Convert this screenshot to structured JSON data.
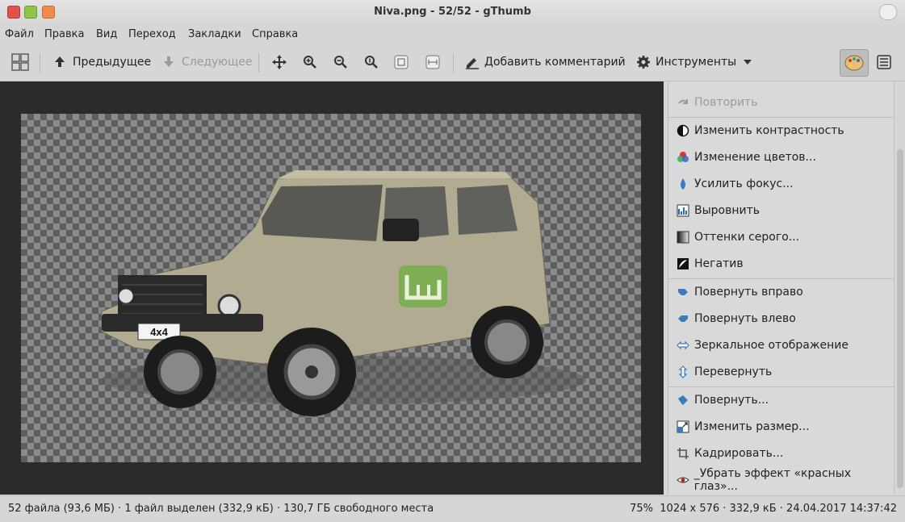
{
  "window": {
    "title": "Niva.png - 52/52 - gThumb"
  },
  "menu": [
    "Файл",
    "Правка",
    "Вид",
    "Переход",
    "Закладки",
    "Справка"
  ],
  "toolbar": {
    "prev_label": "Предыдущее",
    "next_label": "Следующее",
    "comment_label": "Добавить комментарий",
    "tools_label": "Инструменты"
  },
  "viewer": {
    "plate_text": "4x4",
    "accent": "#6fae3f"
  },
  "panel": {
    "items": [
      {
        "label": "Повторить",
        "icon": "redo-icon"
      },
      {
        "label": "Изменить контрастность",
        "icon": "contrast-icon"
      },
      {
        "label": "Изменение цветов...",
        "icon": "colors-icon"
      },
      {
        "label": "Усилить фокус...",
        "icon": "sharpen-icon"
      },
      {
        "label": "Выровнить",
        "icon": "equalize-icon"
      },
      {
        "label": "Оттенки серого...",
        "icon": "grayscale-icon"
      },
      {
        "label": "Негатив",
        "icon": "negative-icon"
      },
      {
        "label": "Повернуть вправо",
        "icon": "rotate-right-icon"
      },
      {
        "label": "Повернуть влево",
        "icon": "rotate-left-icon"
      },
      {
        "label": "Зеркальное отображение",
        "icon": "mirror-icon"
      },
      {
        "label": "Перевернуть",
        "icon": "flip-icon"
      },
      {
        "label": "Повернуть...",
        "icon": "rotate-icon"
      },
      {
        "label": "Изменить размер...",
        "icon": "resize-icon"
      },
      {
        "label": "Кадрировать...",
        "icon": "crop-icon"
      },
      {
        "label": "_Убрать эффект «красных глаз»...",
        "icon": "red-eye-icon"
      }
    ]
  },
  "status": {
    "left": "52 файла (93,6 МБ) · 1 файл выделен (332,9 кБ) · 130,7 ГБ свободного места",
    "zoom": "75%",
    "info": "1024 х 576 · 332,9 кБ · 24.04.2017 14:37:42"
  }
}
